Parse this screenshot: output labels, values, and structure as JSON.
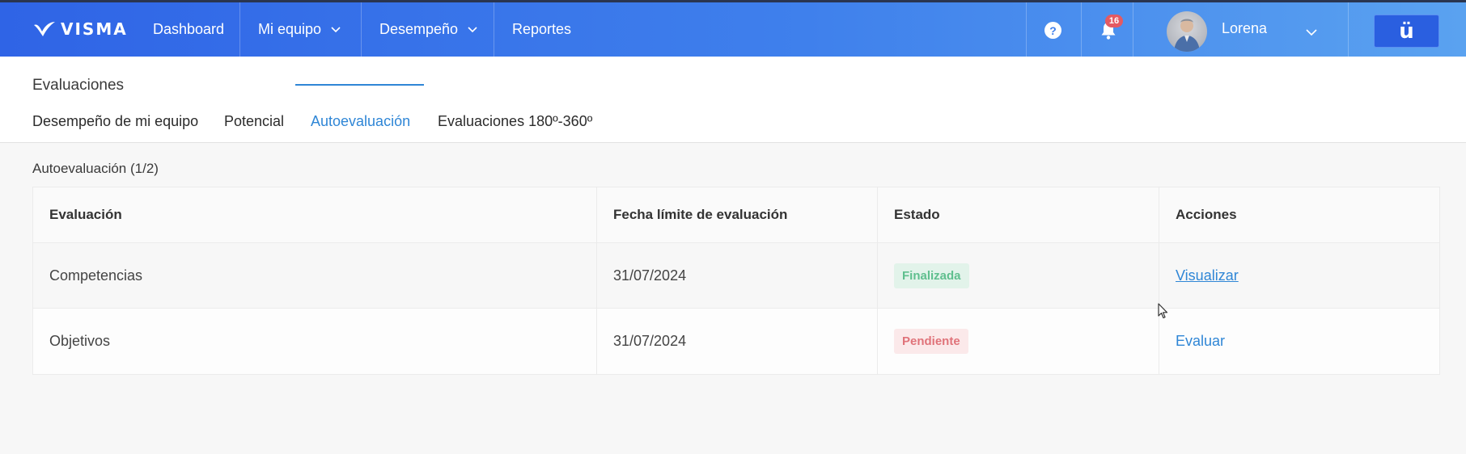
{
  "navbar": {
    "brand": "VISMA",
    "items": [
      {
        "label": "Dashboard",
        "has_dropdown": false
      },
      {
        "label": "Mi equipo",
        "has_dropdown": true
      },
      {
        "label": "Desempeño",
        "has_dropdown": true
      },
      {
        "label": "Reportes",
        "has_dropdown": false
      }
    ],
    "help_icon": "question-circle-icon",
    "notifications_count": "16",
    "user_name": "Lorena",
    "app_button_label": "ü"
  },
  "page": {
    "title": "Evaluaciones",
    "tabs": [
      {
        "label": "Desempeño de mi equipo",
        "active": false
      },
      {
        "label": "Potencial",
        "active": false
      },
      {
        "label": "Autoevaluación",
        "active": true
      },
      {
        "label": "Evaluaciones 180º-360º",
        "active": false
      }
    ]
  },
  "section": {
    "title": "Autoevaluación (1/2)",
    "columns": [
      "Evaluación",
      "Fecha límite de evaluación",
      "Estado",
      "Acciones"
    ],
    "rows": [
      {
        "evaluacion": "Competencias",
        "fecha": "31/07/2024",
        "estado": "Finalizada",
        "accion": "Visualizar"
      },
      {
        "evaluacion": "Objetivos",
        "fecha": "31/07/2024",
        "estado": "Pendiente",
        "accion": "Evaluar"
      }
    ]
  },
  "colors": {
    "navbar_start": "#2f64e6",
    "navbar_end": "#5aa2f0",
    "accent": "#2f86d6",
    "status_done": "#5fbf8e",
    "status_pending": "#e0737a",
    "badge_bg": "#e45a62"
  }
}
